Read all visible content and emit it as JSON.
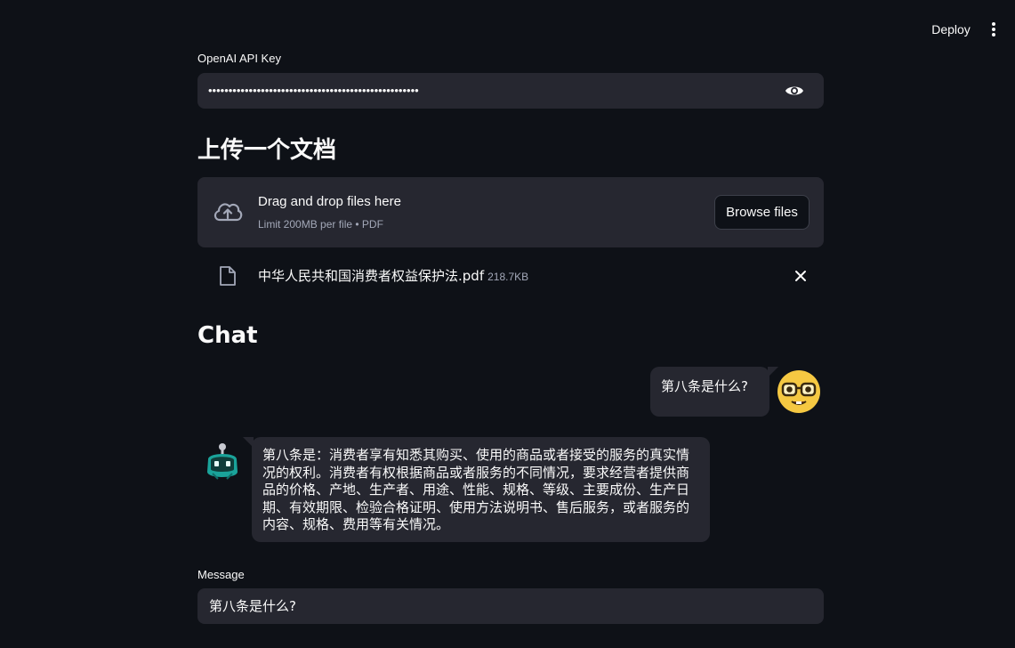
{
  "header": {
    "deploy_label": "Deploy",
    "menu_icon": "kebab-menu-icon"
  },
  "api_key": {
    "label": "OpenAI API Key",
    "masked_value": "••••••••••••••••••••••••••••••••••••••••••••••••••••",
    "toggle_icon": "eye-icon"
  },
  "upload": {
    "heading": "上传一个文档",
    "dropzone_title": "Drag and drop files here",
    "dropzone_limit": "Limit 200MB per file • PDF",
    "browse_label": "Browse files",
    "upload_icon": "cloud-upload-icon",
    "file": {
      "name": "中华人民共和国消费者权益保护法.pdf",
      "size": "218.7KB",
      "file_icon": "document-icon",
      "remove_icon": "close-icon"
    }
  },
  "chat": {
    "heading": "Chat",
    "messages": [
      {
        "role": "user",
        "text": "第八条是什么?",
        "avatar_icon": "nerd-face-avatar-icon"
      },
      {
        "role": "assistant",
        "text": "第八条是：消费者享有知悉其购买、使用的商品或者接受的服务的真实情况的权利。消费者有权根据商品或者服务的不同情况，要求经营者提供商品的价格、产地、生产者、用途、性能、规格、等级、主要成份、生产日期、有效期限、检验合格证明、使用方法说明书、售后服务，或者服务的内容、规格、费用等有关情况。",
        "avatar_icon": "robot-avatar-icon"
      }
    ]
  },
  "message_input": {
    "label": "Message",
    "value": "第八条是什么?"
  },
  "colors": {
    "background": "#0e1117",
    "surface": "#262730",
    "text": "#fafafa",
    "muted_text": "#a3a8b8"
  }
}
